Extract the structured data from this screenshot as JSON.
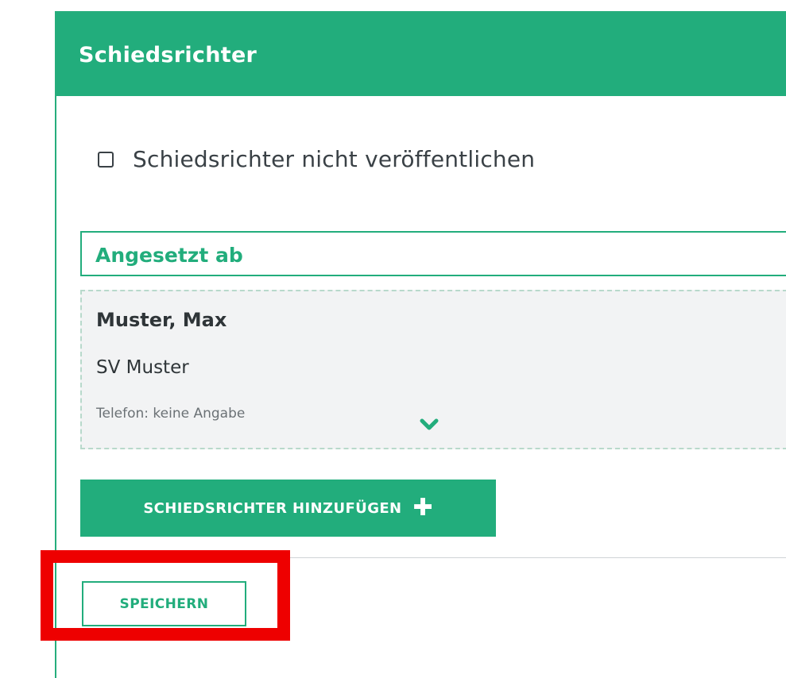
{
  "panel": {
    "title": "Schiedsrichter"
  },
  "publish_option": {
    "label": "Schiedsrichter nicht veröffentlichen",
    "checked": false
  },
  "assignment": {
    "header": "Angesetzt ab",
    "referee": {
      "name": "Muster, Max",
      "club": "SV Muster",
      "phone": "Telefon: keine Angabe"
    }
  },
  "actions": {
    "add_label": "SCHIEDSRICHTER HINZUFÜGEN",
    "add_icon": "plus-icon",
    "save_label": "SPEICHERN"
  },
  "colors": {
    "accent": "#22ad7c",
    "highlight": "#ee0000"
  },
  "icons": {
    "expand": "chevron-down-icon"
  }
}
